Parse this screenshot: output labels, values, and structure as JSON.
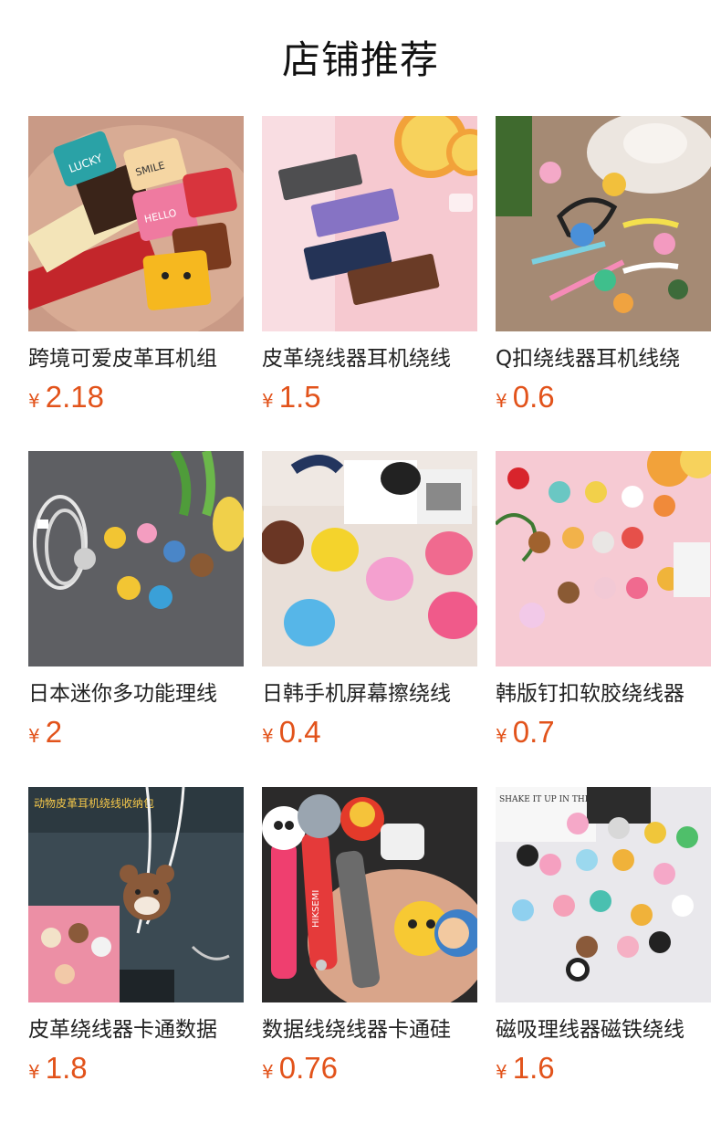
{
  "page": {
    "title": "店铺推荐",
    "accent_color": "#e2531b"
  },
  "products": [
    {
      "name": "跨境可爱皮革耳机组",
      "currency": "¥",
      "price": "2.18",
      "image": "leather-cable-tags-image"
    },
    {
      "name": "皮革绕线器耳机绕线",
      "currency": "¥",
      "price": "1.5",
      "image": "leather-straps-four-colors-image"
    },
    {
      "name": "Q扣绕线器耳机线绕",
      "currency": "¥",
      "price": "0.6",
      "image": "cartoon-q-clips-image"
    },
    {
      "name": "日本迷你多功能理线",
      "currency": "¥",
      "price": "2",
      "image": "animal-cable-clips-gray-image"
    },
    {
      "name": "日韩手机屏幕擦绕线",
      "currency": "¥",
      "price": "0.4",
      "image": "round-screen-wipes-image"
    },
    {
      "name": "韩版钉扣软胶绕线器",
      "currency": "¥",
      "price": "0.7",
      "image": "cartoon-figure-winders-image"
    },
    {
      "name": "皮革绕线器卡通数据",
      "currency": "¥",
      "price": "1.8",
      "image": "bear-earphone-pouch-image",
      "image_caption": "动物皮革耳机绕线收纳包"
    },
    {
      "name": "数据线绕线器卡通硅",
      "currency": "¥",
      "price": "0.76",
      "image": "silicone-cartoon-straps-image",
      "image_caption": "HIKSEMI"
    },
    {
      "name": "磁吸理线器磁铁绕线",
      "currency": "¥",
      "price": "1.6",
      "image": "magnetic-cable-clips-image",
      "image_caption": "SHAKE IT UP IN THE MORNINGS"
    }
  ]
}
